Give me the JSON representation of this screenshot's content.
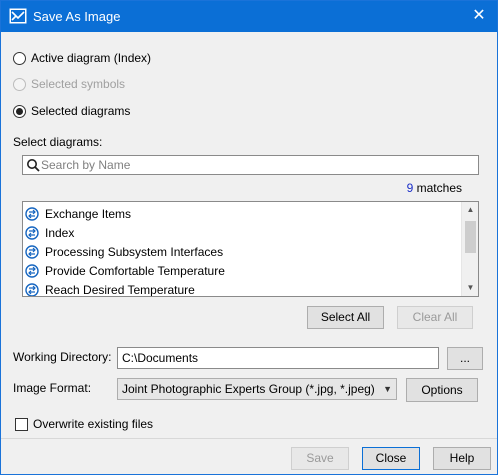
{
  "window": {
    "title": "Save As Image"
  },
  "options": {
    "active_diagram": "Active diagram (Index)",
    "selected_symbols": "Selected symbols",
    "selected_diagrams": "Selected diagrams"
  },
  "select_diagrams": {
    "label": "Select diagrams:",
    "search_placeholder": "Search by Name",
    "match_count": "9",
    "match_suffix": "matches",
    "items": [
      "Exchange Items",
      "Index",
      "Processing Subsystem Interfaces",
      "Provide Comfortable Temperature",
      "Reach Desired Temperature"
    ],
    "select_all": "Select All",
    "clear_all": "Clear All"
  },
  "working_directory": {
    "label": "Working Directory:",
    "value": "C:\\Documents",
    "browse": "..."
  },
  "image_format": {
    "label": "Image Format:",
    "value": "Joint Photographic Experts Group (*.jpg, *.jpeg)",
    "options_button": "Options"
  },
  "overwrite": {
    "label": "Overwrite existing files"
  },
  "footer": {
    "save": "Save",
    "close": "Close",
    "help": "Help"
  },
  "colors": {
    "titlebar": "#0b6fd6",
    "match_count": "#1a2ec8",
    "diagram_icon": "#1565c0"
  }
}
